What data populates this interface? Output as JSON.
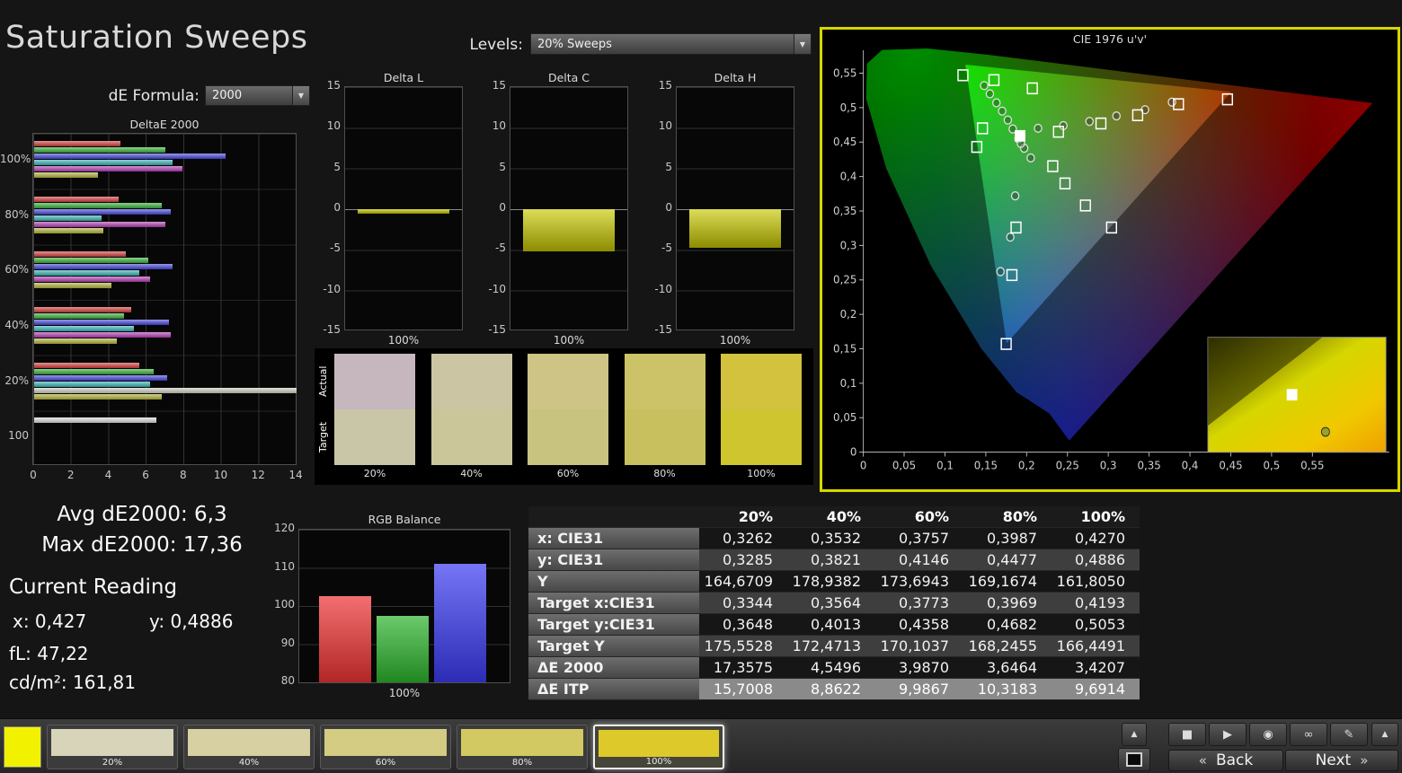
{
  "title": "Saturation Sweeps",
  "controls": {
    "de_formula": {
      "label": "dE Formula:",
      "value": "2000"
    },
    "levels": {
      "label": "Levels:",
      "value": "20% Sweeps"
    }
  },
  "stats": {
    "avg": "Avg dE2000: 6,3",
    "max": "Max dE2000: 17,36",
    "current_reading": "Current Reading",
    "x": "x: 0,427",
    "y": "y: 0,4886",
    "fl": "fL: 47,22",
    "cd": "cd/m²: 161,81"
  },
  "swatch_panel": {
    "row_labels": [
      "Actual",
      "Target"
    ],
    "columns": [
      {
        "label": "20%",
        "actual": "#c6b7bf",
        "target": "#c9c6a8"
      },
      {
        "label": "40%",
        "actual": "#ccc5a4",
        "target": "#cac69a"
      },
      {
        "label": "60%",
        "actual": "#cdc485",
        "target": "#c9c380"
      },
      {
        "label": "80%",
        "actual": "#ccc268",
        "target": "#c8c05f"
      },
      {
        "label": "100%",
        "actual": "#d2c23e",
        "target": "#cfc52e"
      }
    ]
  },
  "chart_data": [
    {
      "id": "deltae2000",
      "type": "bar",
      "orientation": "horizontal",
      "title": "DeltaE 2000",
      "xlim": [
        0,
        14
      ],
      "xticks": [
        "0",
        "2",
        "4",
        "6",
        "8",
        "10",
        "12",
        "14"
      ],
      "clip_color": "#c9c9bb",
      "series_colors": [
        "#d03a3a",
        "#34ac34",
        "#4343d8",
        "#35b0b0",
        "#b03ab0",
        "#b0b03a"
      ],
      "groups": [
        {
          "label": "100%",
          "values": [
            4.6,
            7.0,
            10.2,
            7.4,
            7.9,
            3.4
          ]
        },
        {
          "label": "80%",
          "values": [
            4.5,
            6.8,
            7.3,
            3.6,
            7.0,
            3.7
          ]
        },
        {
          "label": "60%",
          "values": [
            4.9,
            6.1,
            7.4,
            5.6,
            6.2,
            4.1
          ]
        },
        {
          "label": "40%",
          "values": [
            5.2,
            4.8,
            7.2,
            5.3,
            7.3,
            4.4
          ]
        },
        {
          "label": "20%",
          "values": [
            5.6,
            6.4,
            7.1,
            6.2,
            17.36,
            6.8
          ]
        },
        {
          "label": "100",
          "values": [
            6.5
          ],
          "colors": [
            "#d8d8d8"
          ]
        }
      ]
    },
    {
      "id": "delta-l",
      "type": "bar",
      "title": "Delta L",
      "categories": [
        "100%"
      ],
      "values": [
        -0.6
      ],
      "ylim": [
        -15,
        15
      ],
      "yticks": [
        "15",
        "10",
        "5",
        "0",
        "-5",
        "-10",
        "-15"
      ],
      "bar_color": "#c9c900"
    },
    {
      "id": "delta-c",
      "type": "bar",
      "title": "Delta C",
      "categories": [
        "100%"
      ],
      "values": [
        -5.2
      ],
      "ylim": [
        -15,
        15
      ],
      "yticks": [
        "15",
        "10",
        "5",
        "0",
        "-5",
        "-10",
        "-15"
      ],
      "bar_color": "#c9c900"
    },
    {
      "id": "delta-h",
      "type": "bar",
      "title": "Delta H",
      "categories": [
        "100%"
      ],
      "values": [
        -4.7
      ],
      "ylim": [
        -15,
        15
      ],
      "yticks": [
        "15",
        "10",
        "5",
        "0",
        "-5",
        "-10",
        "-15"
      ],
      "bar_color": "#c9c900"
    },
    {
      "id": "rgb-balance",
      "type": "bar",
      "title": "RGB Balance",
      "categories": [
        "Red",
        "Green",
        "Blue"
      ],
      "values": [
        102.5,
        97.5,
        111
      ],
      "colors": [
        "#ee3232",
        "#2cb42c",
        "#3a3af2"
      ],
      "ylim": [
        80,
        120
      ],
      "yticks": [
        "120",
        "110",
        "100",
        "90",
        "80"
      ],
      "xlabel": "100%"
    },
    {
      "id": "cie-diagram",
      "type": "scatter",
      "title": "CIE 1976 u'v'",
      "xticks": [
        "0",
        "0,05",
        "0,1",
        "0,15",
        "0,2",
        "0,25",
        "0,3",
        "0,35",
        "0,4",
        "0,45",
        "0,5",
        "0,55"
      ],
      "yticks": [
        "0",
        "0,05",
        "0,1",
        "0,15",
        "0,2",
        "0,25",
        "0,3",
        "0,35",
        "0,4",
        "0,45",
        "0,5",
        "0,55"
      ],
      "current": {
        "u": 0.192,
        "v": 0.459
      },
      "targets": [
        {
          "u": 0.122,
          "v": 0.547
        },
        {
          "u": 0.16,
          "v": 0.54
        },
        {
          "u": 0.207,
          "v": 0.528
        },
        {
          "u": 0.139,
          "v": 0.443
        },
        {
          "u": 0.146,
          "v": 0.47
        },
        {
          "u": 0.239,
          "v": 0.465
        },
        {
          "u": 0.291,
          "v": 0.477
        },
        {
          "u": 0.336,
          "v": 0.489
        },
        {
          "u": 0.386,
          "v": 0.505
        },
        {
          "u": 0.446,
          "v": 0.512
        },
        {
          "u": 0.232,
          "v": 0.415
        },
        {
          "u": 0.247,
          "v": 0.39
        },
        {
          "u": 0.272,
          "v": 0.358
        },
        {
          "u": 0.304,
          "v": 0.326
        },
        {
          "u": 0.187,
          "v": 0.326
        },
        {
          "u": 0.182,
          "v": 0.257
        },
        {
          "u": 0.175,
          "v": 0.157
        }
      ],
      "measurements": [
        {
          "u": 0.148,
          "v": 0.532
        },
        {
          "u": 0.155,
          "v": 0.52
        },
        {
          "u": 0.163,
          "v": 0.507
        },
        {
          "u": 0.17,
          "v": 0.495
        },
        {
          "u": 0.177,
          "v": 0.482
        },
        {
          "u": 0.183,
          "v": 0.469
        },
        {
          "u": 0.19,
          "v": 0.455
        },
        {
          "u": 0.197,
          "v": 0.441
        },
        {
          "u": 0.205,
          "v": 0.427
        },
        {
          "u": 0.214,
          "v": 0.47
        },
        {
          "u": 0.245,
          "v": 0.474
        },
        {
          "u": 0.277,
          "v": 0.48
        },
        {
          "u": 0.31,
          "v": 0.488
        },
        {
          "u": 0.345,
          "v": 0.497
        },
        {
          "u": 0.378,
          "v": 0.508
        },
        {
          "u": 0.186,
          "v": 0.372
        },
        {
          "u": 0.18,
          "v": 0.312
        },
        {
          "u": 0.168,
          "v": 0.262
        },
        {
          "u": 0.193,
          "v": 0.448
        }
      ]
    },
    {
      "id": "measurements-table",
      "type": "table",
      "header": [
        "",
        "20%",
        "40%",
        "60%",
        "80%",
        "100%"
      ],
      "rows": [
        {
          "label": "x: CIE31",
          "values": [
            "0,3262",
            "0,3532",
            "0,3757",
            "0,3987",
            "0,4270"
          ]
        },
        {
          "label": "y: CIE31",
          "values": [
            "0,3285",
            "0,3821",
            "0,4146",
            "0,4477",
            "0,4886"
          ]
        },
        {
          "label": "Y",
          "values": [
            "164,6709",
            "178,9382",
            "173,6943",
            "169,1674",
            "161,8050"
          ]
        },
        {
          "label": "Target x:CIE31",
          "values": [
            "0,3344",
            "0,3564",
            "0,3773",
            "0,3969",
            "0,4193"
          ]
        },
        {
          "label": "Target y:CIE31",
          "values": [
            "0,3648",
            "0,4013",
            "0,4358",
            "0,4682",
            "0,5053"
          ]
        },
        {
          "label": "Target Y",
          "values": [
            "175,5528",
            "172,4713",
            "170,1037",
            "168,2455",
            "166,4491"
          ]
        },
        {
          "label": "ΔE 2000",
          "values": [
            "17,3575",
            "4,5496",
            "3,9870",
            "3,6464",
            "3,4207"
          ]
        },
        {
          "label": "ΔE ITP",
          "values": [
            "15,7008",
            "8,8622",
            "9,9867",
            "10,3183",
            "9,6914"
          ]
        }
      ]
    }
  ],
  "bottom_bar": {
    "indicator_color": "#f2f200",
    "swatches": [
      {
        "label": "20%",
        "color": "#d8d4ba",
        "selected": false
      },
      {
        "label": "40%",
        "color": "#d6d0a2",
        "selected": false
      },
      {
        "label": "60%",
        "color": "#d3cc82",
        "selected": false
      },
      {
        "label": "80%",
        "color": "#d2c962",
        "selected": false
      },
      {
        "label": "100%",
        "color": "#ddca2a",
        "selected": true
      }
    ],
    "icons": [
      {
        "name": "stop-icon",
        "glyph": "■"
      },
      {
        "name": "play-icon",
        "glyph": "▶"
      },
      {
        "name": "single-measure-icon",
        "glyph": "◉"
      },
      {
        "name": "continuous-measure-icon",
        "glyph": "∞"
      },
      {
        "name": "edit-icon",
        "glyph": "✎"
      }
    ],
    "up_glyph": "▲",
    "back_glyph": "«",
    "back_label": "Back",
    "next_label": "Next",
    "next_glyph": "»"
  }
}
